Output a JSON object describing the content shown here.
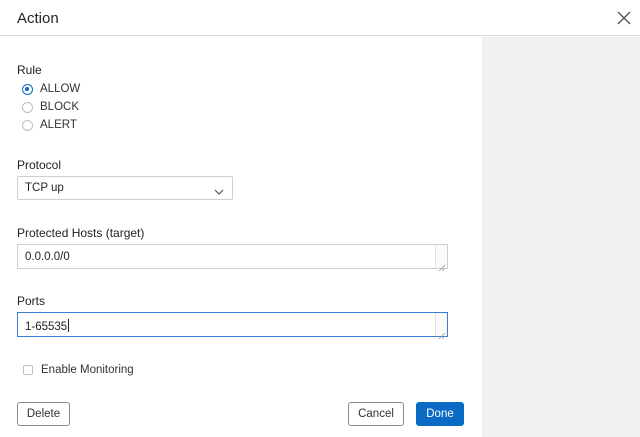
{
  "dialog": {
    "title": "Action"
  },
  "rule": {
    "label": "Rule",
    "options": [
      {
        "label": "ALLOW",
        "selected": true
      },
      {
        "label": "BLOCK",
        "selected": false
      },
      {
        "label": "ALERT",
        "selected": false
      }
    ]
  },
  "protocol": {
    "label": "Protocol",
    "value": "TCP up"
  },
  "protected_hosts": {
    "label": "Protected Hosts (target)",
    "value": "0.0.0.0/0"
  },
  "ports": {
    "label": "Ports",
    "value": "1-65535"
  },
  "monitoring": {
    "label": "Enable Monitoring",
    "checked": false
  },
  "buttons": {
    "delete": "Delete",
    "cancel": "Cancel",
    "done": "Done"
  },
  "colors": {
    "primary": "#0b6bc4",
    "panel": "#f0f0f0",
    "border": "#cfcfcf"
  },
  "icons": {
    "close": "close-icon",
    "dropdown": "chevron-down-icon"
  }
}
